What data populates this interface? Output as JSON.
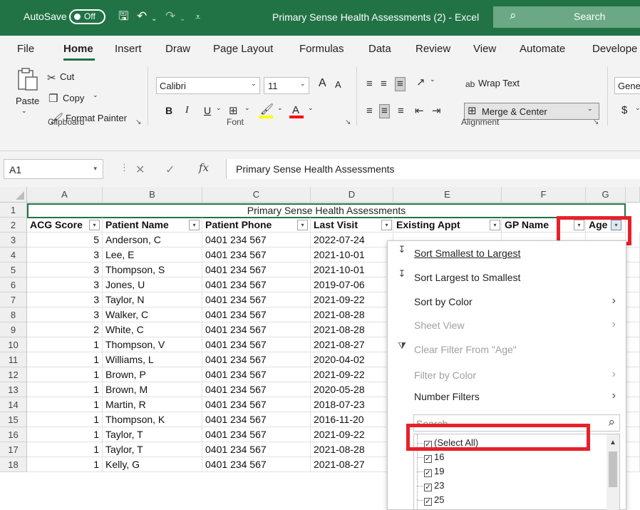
{
  "titlebar": {
    "autosave_label": "AutoSave",
    "autosave_state": "Off",
    "document_title": "Primary Sense Health Assessments (2)  -  Excel",
    "search_label": "Search",
    "accent_color": "#217346"
  },
  "tabs": [
    "File",
    "Home",
    "Insert",
    "Draw",
    "Page Layout",
    "Formulas",
    "Data",
    "Review",
    "View",
    "Automate",
    "Develope"
  ],
  "active_tab": "Home",
  "ribbon": {
    "clipboard": {
      "paste": "Paste",
      "cut": "Cut",
      "copy": "Copy",
      "format_painter": "Format Painter",
      "group_label": "Clipboard"
    },
    "font": {
      "font_name": "Calibri",
      "font_size": "11",
      "bold": "B",
      "italic": "I",
      "underline": "U",
      "font_color_glyph": "A",
      "grow": "A",
      "shrink": "A",
      "group_label": "Font"
    },
    "alignment": {
      "wrap_text": "Wrap Text",
      "merge_center": "Merge & Center",
      "group_label": "Alignment"
    },
    "number": {
      "format": "Gener",
      "currency": "$"
    }
  },
  "formula_bar": {
    "name_box": "A1",
    "fx": "fx",
    "formula": "Primary Sense Health Assessments"
  },
  "columns": [
    "A",
    "B",
    "C",
    "D",
    "E",
    "F",
    "G"
  ],
  "sheet": {
    "title": "Primary Sense Health Assessments",
    "headers": [
      "ACG Score",
      "Patient Name",
      "Patient Phone",
      "Last Visit",
      "Existing Appt",
      "GP Name",
      "Age"
    ],
    "rows": [
      {
        "n": "3",
        "score": "5",
        "name": "Anderson, C",
        "phone": "0401 234 567",
        "visit": "2022-07-24"
      },
      {
        "n": "4",
        "score": "3",
        "name": "Lee, E",
        "phone": "0401 234 567",
        "visit": "2021-10-01"
      },
      {
        "n": "5",
        "score": "3",
        "name": "Thompson, S",
        "phone": "0401 234 567",
        "visit": "2021-10-01"
      },
      {
        "n": "6",
        "score": "3",
        "name": "Jones, U",
        "phone": "0401 234 567",
        "visit": "2019-07-06"
      },
      {
        "n": "7",
        "score": "3",
        "name": "Taylor, N",
        "phone": "0401 234 567",
        "visit": "2021-09-22"
      },
      {
        "n": "8",
        "score": "3",
        "name": "Walker, C",
        "phone": "0401 234 567",
        "visit": "2021-08-28"
      },
      {
        "n": "9",
        "score": "2",
        "name": "White, C",
        "phone": "0401 234 567",
        "visit": "2021-08-28"
      },
      {
        "n": "10",
        "score": "1",
        "name": "Thompson, V",
        "phone": "0401 234 567",
        "visit": "2021-08-27"
      },
      {
        "n": "11",
        "score": "1",
        "name": "Williams, L",
        "phone": "0401 234 567",
        "visit": "2020-04-02"
      },
      {
        "n": "12",
        "score": "1",
        "name": "Brown, P",
        "phone": "0401 234 567",
        "visit": "2021-09-22"
      },
      {
        "n": "13",
        "score": "1",
        "name": "Brown, M",
        "phone": "0401 234 567",
        "visit": "2020-05-28"
      },
      {
        "n": "14",
        "score": "1",
        "name": "Martin, R",
        "phone": "0401 234 567",
        "visit": "2018-07-23"
      },
      {
        "n": "15",
        "score": "1",
        "name": "Thompson, K",
        "phone": "0401 234 567",
        "visit": "2016-11-20"
      },
      {
        "n": "16",
        "score": "1",
        "name": "Taylor, T",
        "phone": "0401 234 567",
        "visit": "2021-09-22"
      },
      {
        "n": "17",
        "score": "1",
        "name": "Taylor, T",
        "phone": "0401 234 567",
        "visit": "2021-08-28"
      },
      {
        "n": "18",
        "score": "1",
        "name": "Kelly, G",
        "phone": "0401 234 567",
        "visit": "2021-08-27"
      }
    ]
  },
  "filter_menu": {
    "sort_asc": "Sort Smallest to Largest",
    "sort_desc": "Sort Largest to Smallest",
    "sort_by_color": "Sort by Color",
    "sheet_view": "Sheet View",
    "clear_filter": "Clear Filter From \"Age\"",
    "filter_by_color": "Filter by Color",
    "number_filters": "Number Filters",
    "search_placeholder": "Search",
    "items": [
      "(Select All)",
      "16",
      "19",
      "23",
      "25"
    ]
  },
  "annotation_color": "#e8202a"
}
